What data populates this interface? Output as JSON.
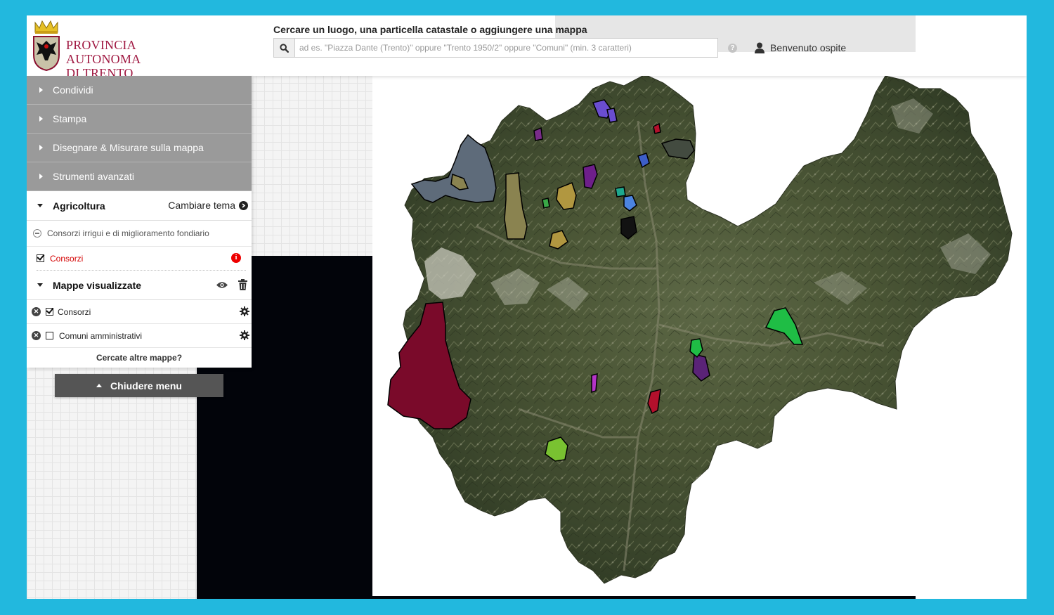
{
  "header": {
    "logo_line1": "PROVINCIA AUTONOMA",
    "logo_line2": "DI TRENTO",
    "search_title": "Cercare un luogo, una particella catastale o aggiungere una mappa",
    "search_placeholder": "ad es. \"Piazza Dante (Trento)\" oppure \"Trento 1950/2\" oppure \"Comuni\" (min. 3 caratteri)",
    "user_label": "Benvenuto ospite"
  },
  "menu": {
    "items": [
      {
        "label": "Condividi"
      },
      {
        "label": "Stampa"
      },
      {
        "label": "Disegnare & Misurare sulla mappa"
      },
      {
        "label": "Strumenti avanzati"
      }
    ],
    "theme": {
      "title": "Agricoltura",
      "change_label": "Cambiare tema",
      "group_label": "Consorzi irrigui e di miglioramento fondiario",
      "layer_label": "Consorzi"
    },
    "mappe": {
      "title": "Mappe visualizzate",
      "layers": [
        {
          "label": "Consorzi",
          "checked": true
        },
        {
          "label": "Comuni amministrativi",
          "checked": false
        }
      ],
      "more_label": "Cercate altre mappe?"
    },
    "close_label": "Chiudere menu"
  },
  "colors": {
    "frame_border": "#22b8de",
    "logo_red": "#a01942",
    "menu_grey": "#9a9a9a",
    "layer_red": "#d40000",
    "consorzio_maroon": "#7a0a2a",
    "consorzio_slate": "#5e6b7a",
    "consorzio_olive": "#8a8350",
    "consorzio_green": "#1fbd45"
  }
}
